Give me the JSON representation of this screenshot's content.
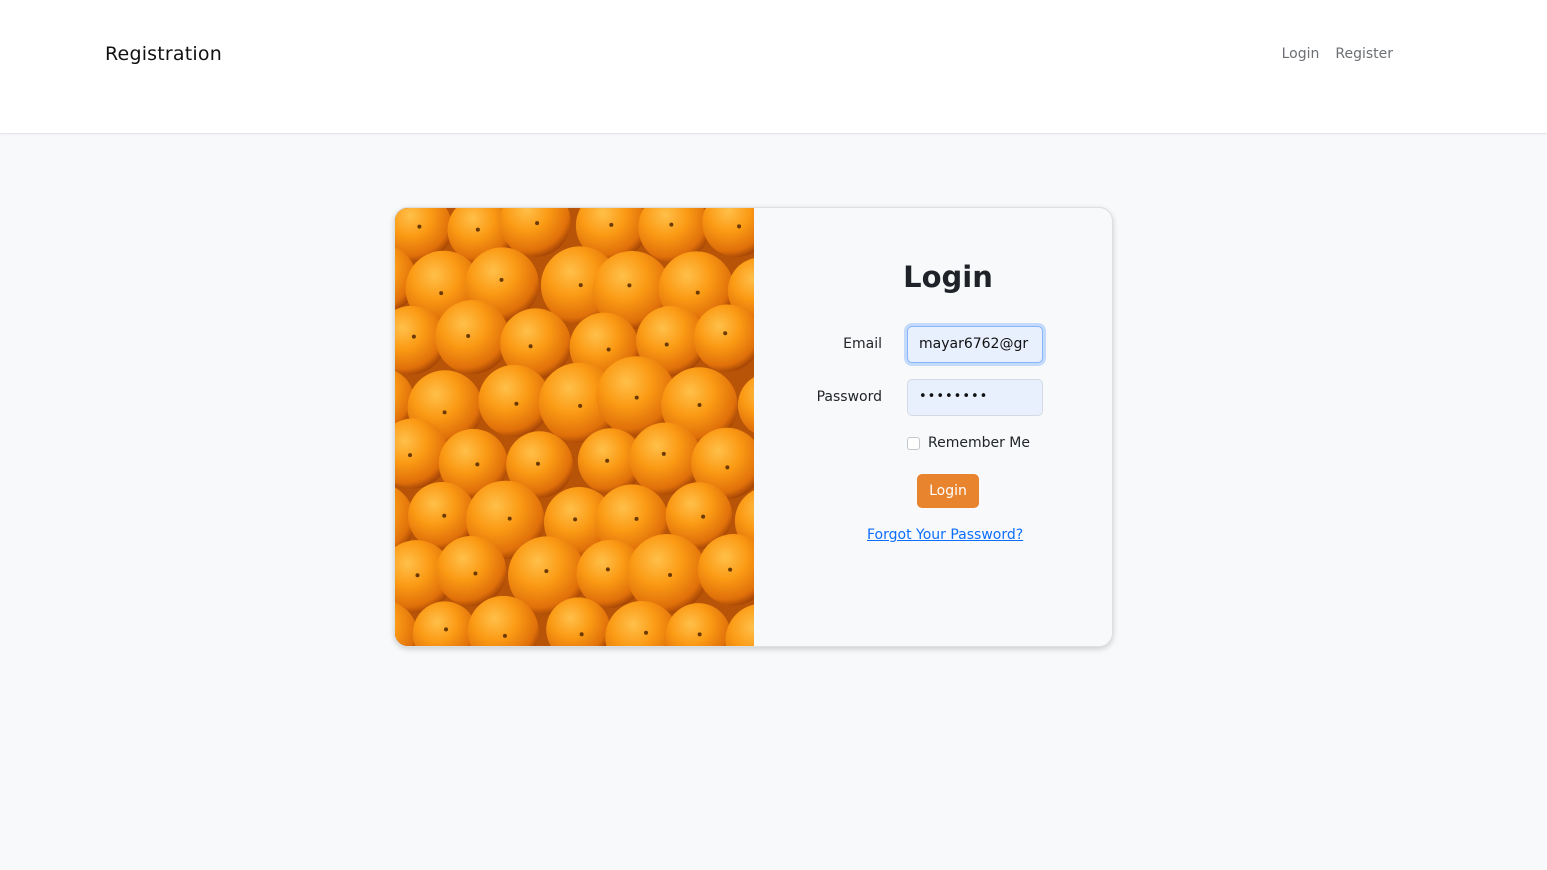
{
  "navbar": {
    "brand": "Registration",
    "links": [
      "Login",
      "Register"
    ]
  },
  "login_card": {
    "title": "Login",
    "email_label": "Email",
    "email_value": "mayar6762@gr",
    "password_label": "Password",
    "password_value": "••••••••",
    "remember_label": "Remember Me",
    "remember_checked": false,
    "submit_label": "Login",
    "forgot_link": "Forgot Your Password?"
  },
  "colors": {
    "accent": "#e8832e",
    "link": "#0d6efd",
    "input_background": "#e8f0fe"
  },
  "image": {
    "subject": "oranges-photo"
  }
}
